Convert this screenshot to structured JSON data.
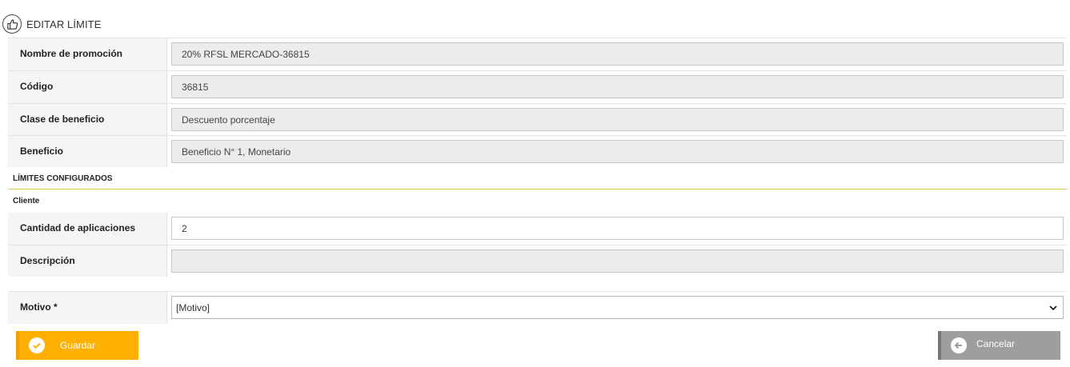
{
  "header": {
    "title": "EDITAR LÍMITE",
    "icon": "thumbs-up-icon"
  },
  "fields": [
    {
      "label": "Nombre de promoción",
      "value": "20% RFSL MERCADO-36815"
    },
    {
      "label": "Código",
      "value": "36815"
    },
    {
      "label": "Clase de beneficio",
      "value": "Descuento porcentaje"
    },
    {
      "label": "Beneficio",
      "value": "Beneficio N° 1, Monetario"
    }
  ],
  "limits": {
    "section_title": "LÍMITES CONFIGURADOS",
    "group_title": "Cliente",
    "cantidad": {
      "label": "Cantidad de aplicaciones",
      "value": "2"
    },
    "descripcion": {
      "label": "Descripción",
      "value": ""
    }
  },
  "motivo": {
    "label": "Motivo *",
    "selected": "[Motivo]"
  },
  "buttons": {
    "save": {
      "label": "Guardar",
      "icon": "check-icon",
      "color": "#ffb000"
    },
    "cancel": {
      "label": "Cancelar",
      "icon": "arrow-left-icon",
      "color": "#9e9e9e"
    }
  }
}
